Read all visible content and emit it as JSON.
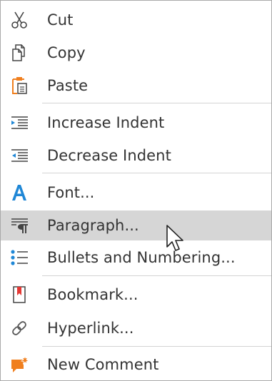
{
  "menu": {
    "items": [
      {
        "label": "Cut",
        "icon": "scissors-icon"
      },
      {
        "label": "Copy",
        "icon": "copy-icon"
      },
      {
        "label": "Paste",
        "icon": "paste-icon"
      },
      {
        "label": "Increase Indent",
        "icon": "increase-indent-icon"
      },
      {
        "label": "Decrease Indent",
        "icon": "decrease-indent-icon"
      },
      {
        "label": "Font...",
        "icon": "font-icon"
      },
      {
        "label": "Paragraph...",
        "icon": "paragraph-icon"
      },
      {
        "label": "Bullets and Numbering...",
        "icon": "bullets-icon"
      },
      {
        "label": "Bookmark...",
        "icon": "bookmark-icon"
      },
      {
        "label": "Hyperlink...",
        "icon": "hyperlink-icon"
      },
      {
        "label": "New Comment",
        "icon": "new-comment-icon"
      }
    ],
    "hovered_item": "Paragraph..."
  },
  "colors": {
    "text": "#333333",
    "hover_background": "#d6d6d6",
    "separator": "#d3d3d3",
    "accent_blue": "#1f87d6",
    "accent_orange": "#f07f1e",
    "bookmark_red": "#e53935"
  }
}
